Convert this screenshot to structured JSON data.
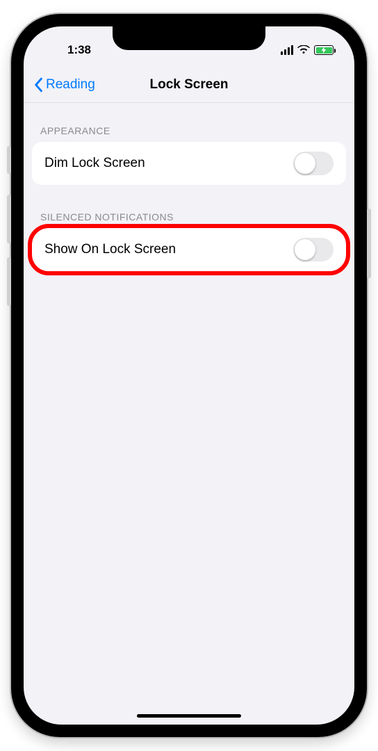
{
  "status": {
    "time": "1:38"
  },
  "nav": {
    "back_label": "Reading",
    "title": "Lock Screen"
  },
  "sections": {
    "appearance": {
      "header": "APPEARANCE",
      "dim_label": "Dim Lock Screen"
    },
    "silenced": {
      "header": "SILENCED NOTIFICATIONS",
      "show_label": "Show On Lock Screen"
    }
  }
}
